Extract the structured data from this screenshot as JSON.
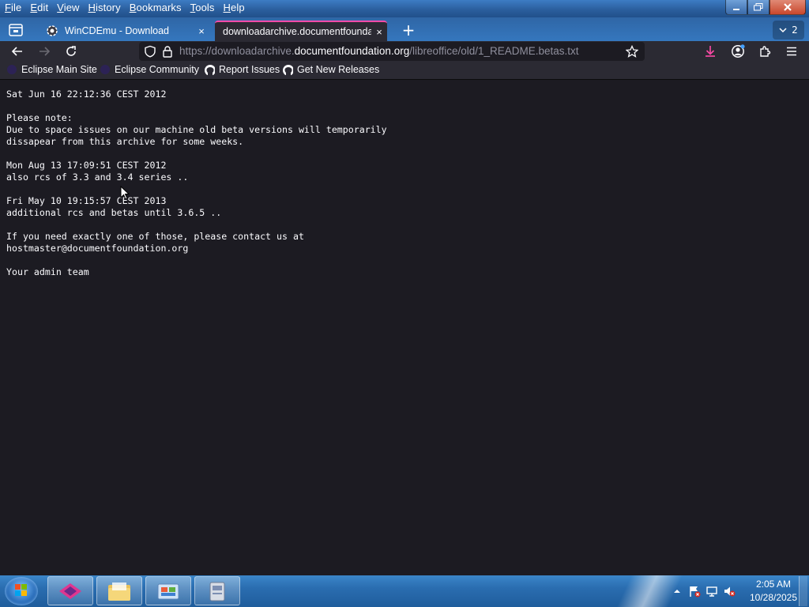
{
  "menu": [
    {
      "label": "File",
      "key": "F",
      "rest": "ile"
    },
    {
      "label": "Edit",
      "key": "E",
      "rest": "dit"
    },
    {
      "label": "View",
      "key": "V",
      "rest": "iew"
    },
    {
      "label": "History",
      "key": "H",
      "rest": "istory"
    },
    {
      "label": "Bookmarks",
      "key": "B",
      "rest": "ookmarks"
    },
    {
      "label": "Tools",
      "key": "T",
      "rest": "ools"
    },
    {
      "label": "Help",
      "key": "H",
      "rest": "elp"
    }
  ],
  "tabs": [
    {
      "title": "WinCDEmu - Download",
      "close": "×"
    },
    {
      "title": "downloadarchive.documentfoundat",
      "close": "×"
    }
  ],
  "tab_count": "2",
  "url": {
    "prefix": "https://downloadarchive.",
    "host": "documentfoundation.org",
    "path": "/libreoffice/old/1_README.betas.txt"
  },
  "bookmarks": [
    "Eclipse Main Site",
    "Eclipse Community",
    "Report Issues",
    "Get New Releases"
  ],
  "readme_lines": [
    "Sat Jun 16 22:12:36 CEST 2012",
    "",
    "Please note:",
    "Due to space issues on our machine old beta versions will temporarily",
    "dissapear from this archive for some weeks.",
    "",
    "Mon Aug 13 17:09:51 CEST 2012",
    "also rcs of 3.3 and 3.4 series ..",
    "",
    "Fri May 10 19:15:57 CEST 2013",
    "additional rcs and betas until 3.6.5 ..",
    "",
    "If you need exactly one of those, please contact us at",
    "hostmaster@documentfoundation.org",
    "",
    "Your admin team"
  ],
  "clock": {
    "time": "2:05 AM",
    "date": "10/28/2025"
  },
  "colors": {
    "accent_tab": "#ff4aa8",
    "page_bg": "#1c1b22",
    "toolbar_bg": "#2b2a33"
  }
}
